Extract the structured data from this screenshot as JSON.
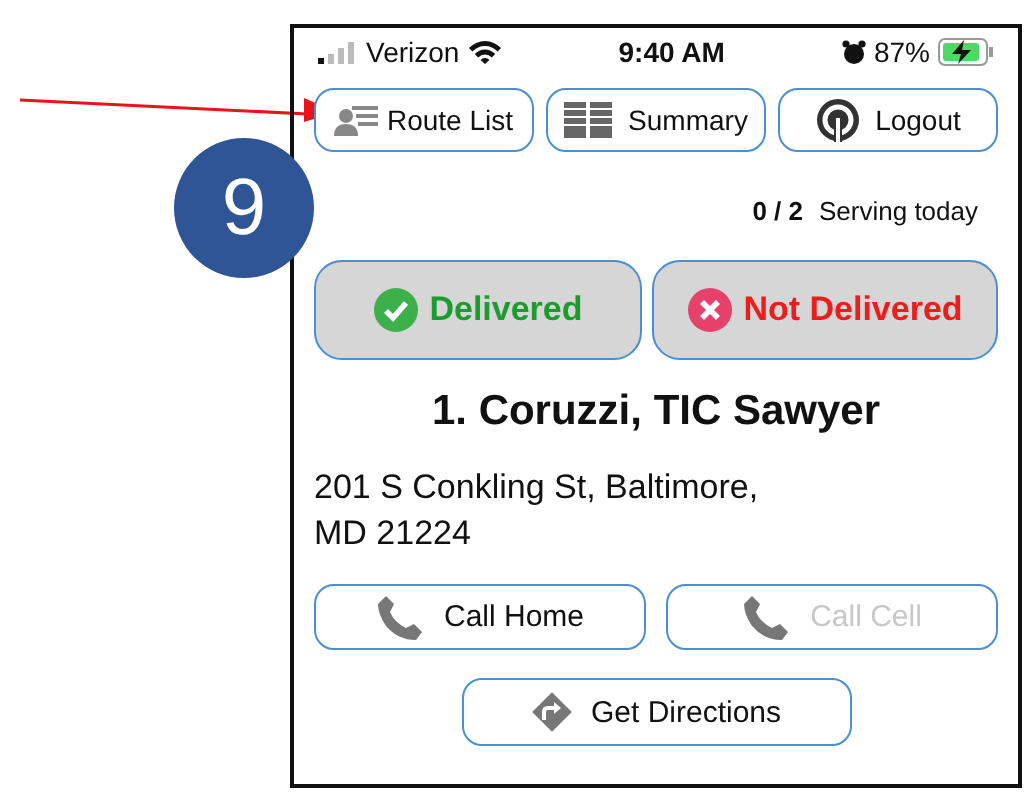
{
  "annotation": {
    "number": "9"
  },
  "status_bar": {
    "carrier": "Verizon",
    "time": "9:40 AM",
    "battery": "87%",
    "charging": true
  },
  "nav_buttons": [
    {
      "label": "Route List",
      "kind": "route"
    },
    {
      "label": "Summary",
      "kind": "summary"
    },
    {
      "label": "Logout",
      "kind": "logout"
    }
  ],
  "progress": {
    "count": "0",
    "separator": "/",
    "total": "2",
    "label": "Serving today"
  },
  "status_buttons": [
    {
      "label": "Delivered",
      "kind": "delivered"
    },
    {
      "label": "Not Delivered",
      "kind": "not_delivered"
    }
  ],
  "stop": {
    "title": "1. Coruzzi, TIC Sawyer",
    "address": "201 S Conkling St, Baltimore,\nMD 21224"
  },
  "call_buttons": [
    {
      "label": "Call Home",
      "disabled": false
    },
    {
      "label": "Call Cell",
      "disabled": true
    }
  ],
  "directions_button": {
    "label": "Get Directions"
  }
}
